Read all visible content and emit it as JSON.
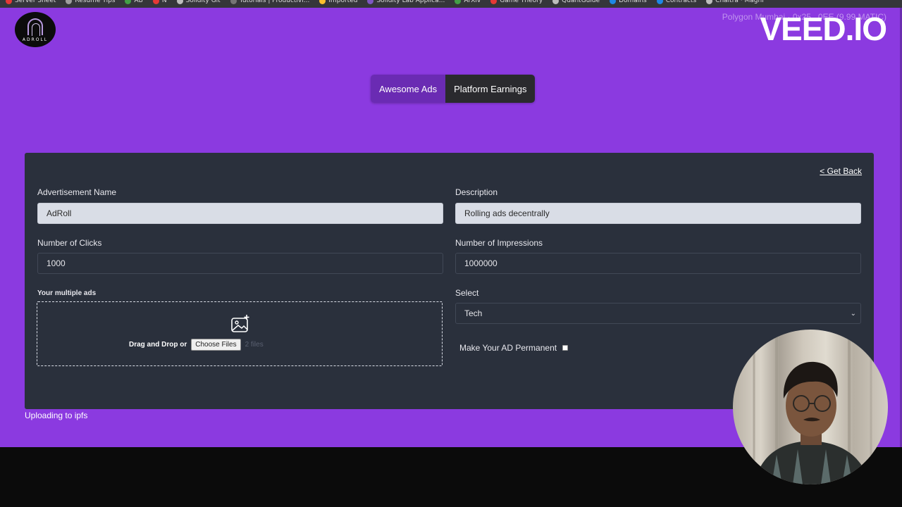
{
  "bookmarks": [
    {
      "label": "Server Sheet",
      "color": "#e53935"
    },
    {
      "label": "Resume Tips",
      "color": "#9e9e9e"
    },
    {
      "label": "AB",
      "color": "#43a047"
    },
    {
      "label": "N",
      "color": "#e53935"
    },
    {
      "label": "Solidity Git",
      "color": "#bdbdbd"
    },
    {
      "label": "Tutorials | Productivi...",
      "color": "#757575"
    },
    {
      "label": "Imported",
      "color": "#fbc02d"
    },
    {
      "label": "Solidity Lab Applica...",
      "color": "#7e57c2"
    },
    {
      "label": "ArXiv",
      "color": "#43a047"
    },
    {
      "label": "Game Theory",
      "color": "#e53935"
    },
    {
      "label": "QuantGuide",
      "color": "#bdbdbd"
    },
    {
      "label": "Domains",
      "color": "#1e88e5"
    },
    {
      "label": "Contracts",
      "color": "#1e88e5"
    },
    {
      "label": "Chaitra · Maghi",
      "color": "#bdbdbd"
    }
  ],
  "logo": {
    "text": "ADROLL"
  },
  "watermark": {
    "text": "VEED.IO",
    "underlay": "Polygon Mumbai · 0x25...0EE (9.99 MATIC)"
  },
  "tabs": [
    {
      "label": "Awesome Ads",
      "active": true
    },
    {
      "label": "Platform Earnings",
      "active": false
    }
  ],
  "form": {
    "back_label": "< Get Back",
    "ad_name": {
      "label": "Advertisement Name",
      "value": "AdRoll"
    },
    "description": {
      "label": "Description",
      "value": "Rolling ads decentrally"
    },
    "clicks": {
      "label": "Number of Clicks",
      "value": "1000"
    },
    "impressions": {
      "label": "Number of Impressions",
      "value": "1000000"
    },
    "ads_upload": {
      "label": "Your multiple ads",
      "drag_text": "Drag and Drop or",
      "button_label": "Choose Files",
      "files_text": "2 files"
    },
    "select": {
      "label": "Select",
      "value": "Tech"
    },
    "permanent": {
      "label": "Make Your AD Permanent",
      "checked": false
    }
  },
  "status_text": "Uploading to ipfs",
  "colors": {
    "background": "#8b3ae0",
    "card": "#2a303c",
    "tab_active": "#6a2bb3",
    "tab_dark": "#2a2a2e"
  }
}
